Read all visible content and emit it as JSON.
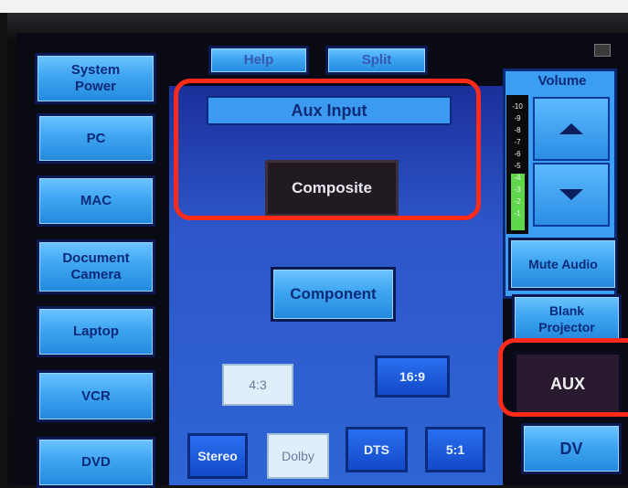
{
  "top_bar": {
    "help_label": "Help",
    "split_label": "Split"
  },
  "left_sidebar": {
    "items": [
      {
        "label": "System Power"
      },
      {
        "label": "PC"
      },
      {
        "label": "MAC"
      },
      {
        "label": "Document Camera"
      },
      {
        "label": "Laptop"
      },
      {
        "label": "VCR"
      },
      {
        "label": "DVD"
      }
    ]
  },
  "aux_panel": {
    "title": "Aux Input",
    "composite_label": "Composite",
    "component_label": "Component",
    "aspect_4_3": "4:3",
    "aspect_16_9": "16:9",
    "audio": [
      "Stereo",
      "Dolby",
      "DTS",
      "5:1"
    ]
  },
  "volume": {
    "title": "Volume",
    "meter_labels": [
      "-10",
      "-9",
      "-8",
      "-7",
      "-6",
      "-5",
      "-4",
      "-3",
      "-2",
      "-1"
    ],
    "up_icon": "triangle-up-icon",
    "down_icon": "triangle-down-icon"
  },
  "right_buttons": {
    "mute_audio": "Mute Audio",
    "blank_projector": "Blank Projector",
    "aux": "AUX",
    "dv": "DV"
  },
  "colors": {
    "highlight_red": "#ff2a1a",
    "button_blue": "#3ea5f2",
    "panel_blue": "#2d56c9",
    "selected_dark": "#211a22",
    "meter_green": "#5ed84a"
  }
}
